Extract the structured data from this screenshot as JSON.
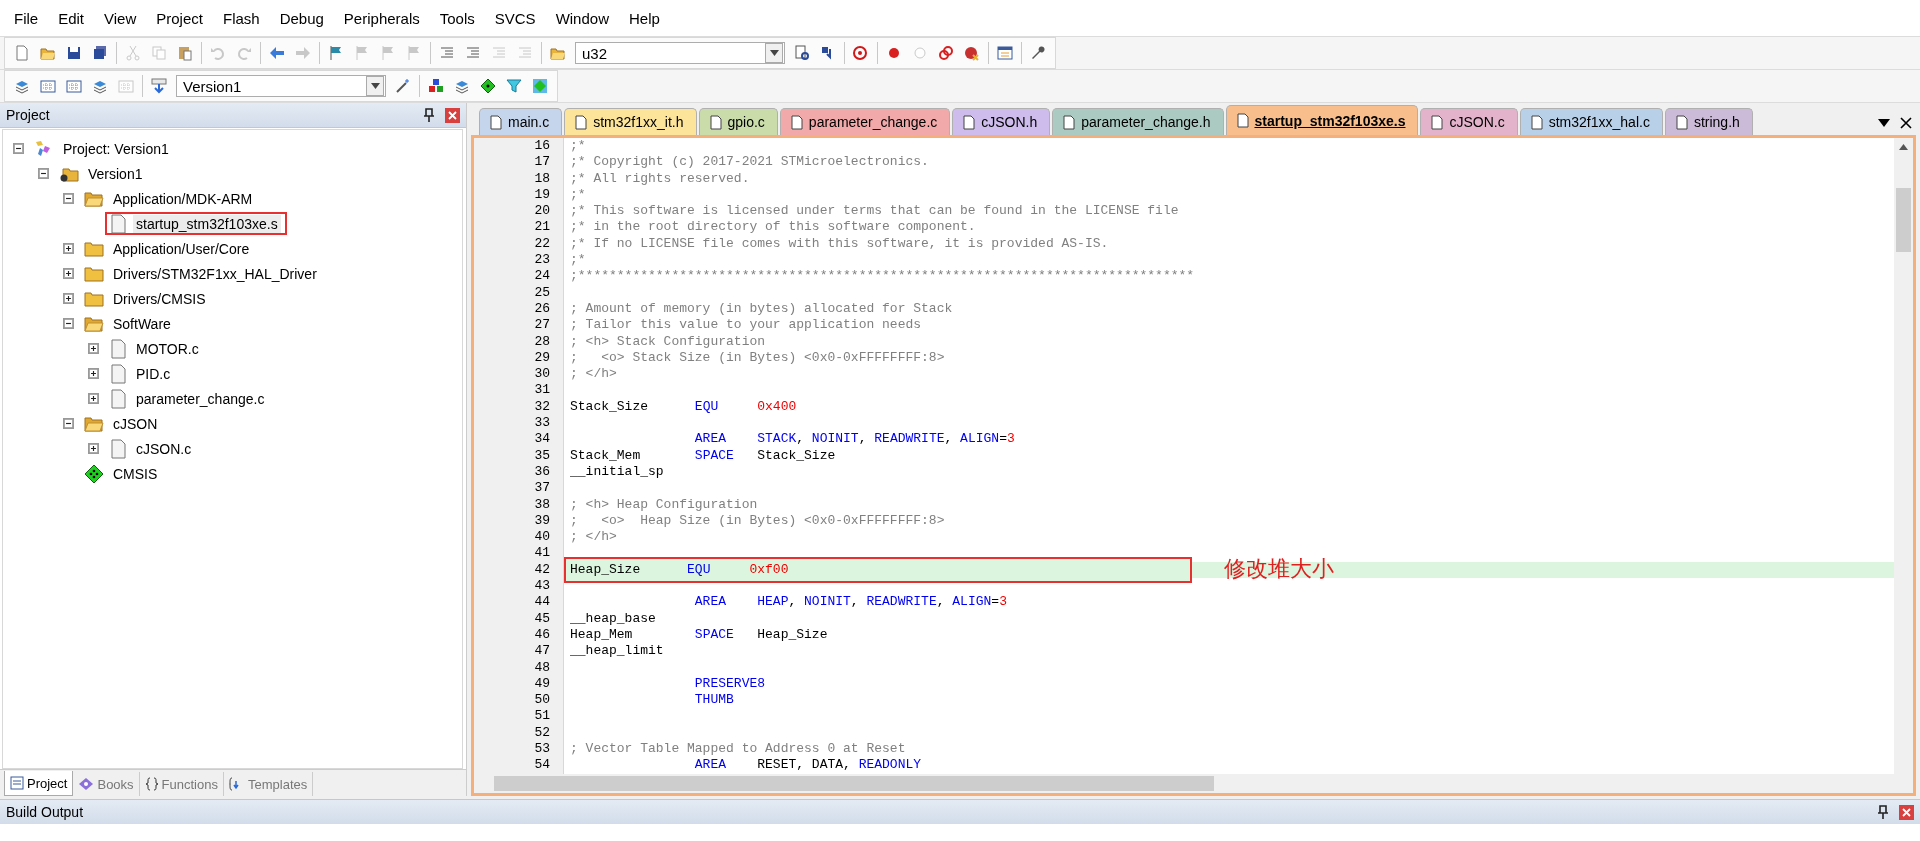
{
  "menu": [
    "File",
    "Edit",
    "View",
    "Project",
    "Flash",
    "Debug",
    "Peripherals",
    "Tools",
    "SVCS",
    "Window",
    "Help"
  ],
  "toolbar_1": [
    {
      "kind": "icon",
      "disabled": false
    },
    {
      "kind": "icon",
      "disabled": false
    },
    {
      "kind": "icon",
      "disabled": false
    },
    {
      "kind": "icon",
      "disabled": false
    },
    {
      "kind": "separator"
    },
    {
      "kind": "icon",
      "disabled": true
    },
    {
      "kind": "icon",
      "disabled": true
    },
    {
      "kind": "icon",
      "disabled": false
    },
    {
      "kind": "separator"
    },
    {
      "kind": "icon",
      "disabled": true
    },
    {
      "kind": "icon",
      "disabled": true
    },
    {
      "kind": "separator"
    },
    {
      "kind": "icon",
      "disabled": false
    },
    {
      "kind": "icon",
      "disabled": true
    },
    {
      "kind": "separator"
    },
    {
      "kind": "icon",
      "disabled": false
    },
    {
      "kind": "icon",
      "disabled": true
    },
    {
      "kind": "icon",
      "disabled": true
    },
    {
      "kind": "icon",
      "disabled": true
    },
    {
      "kind": "separator"
    },
    {
      "kind": "icon",
      "disabled": false
    },
    {
      "kind": "icon",
      "disabled": false
    },
    {
      "kind": "icon",
      "disabled": true
    },
    {
      "kind": "icon",
      "disabled": true
    },
    {
      "kind": "separator"
    },
    {
      "kind": "icon",
      "disabled": false
    },
    {
      "kind": "combo",
      "value": "u32"
    },
    {
      "kind": "icon",
      "disabled": false
    },
    {
      "kind": "icon",
      "disabled": false
    },
    {
      "kind": "separator"
    },
    {
      "kind": "icon",
      "disabled": false
    },
    {
      "kind": "separator"
    },
    {
      "kind": "icon",
      "disabled": false
    },
    {
      "kind": "icon",
      "disabled": true
    },
    {
      "kind": "icon",
      "disabled": false
    },
    {
      "kind": "icon",
      "disabled": false
    },
    {
      "kind": "separator"
    },
    {
      "kind": "icon",
      "disabled": false
    },
    {
      "kind": "separator"
    },
    {
      "kind": "icon",
      "disabled": false
    }
  ],
  "toolbar_2": [
    {
      "kind": "icon",
      "disabled": false
    },
    {
      "kind": "icon",
      "disabled": false
    },
    {
      "kind": "icon",
      "disabled": false
    },
    {
      "kind": "icon",
      "disabled": false
    },
    {
      "kind": "icon",
      "disabled": true
    },
    {
      "kind": "separator"
    },
    {
      "kind": "icon",
      "disabled": false
    },
    {
      "kind": "combo",
      "value": "Version1"
    },
    {
      "kind": "icon",
      "disabled": false
    },
    {
      "kind": "separator"
    },
    {
      "kind": "icon",
      "disabled": false
    },
    {
      "kind": "icon",
      "disabled": false
    },
    {
      "kind": "icon",
      "disabled": false
    },
    {
      "kind": "icon",
      "disabled": false
    },
    {
      "kind": "icon",
      "disabled": false
    }
  ],
  "project_panel": {
    "title": "Project",
    "tree": [
      {
        "kind": "project",
        "label": "Project: Version1",
        "expandable": true,
        "expanded": true,
        "selected": false,
        "marked": false,
        "children": [
          {
            "kind": "target",
            "label": "Version1",
            "expandable": true,
            "expanded": true,
            "selected": false,
            "marked": false,
            "children": [
              {
                "kind": "group",
                "label": "Application/MDK-ARM",
                "expandable": true,
                "expanded": true,
                "selected": false,
                "marked": false,
                "children": [
                  {
                    "kind": "file",
                    "label": "startup_stm32f103xe.s",
                    "expandable": false,
                    "expanded": false,
                    "selected": true,
                    "marked": true
                  }
                ]
              },
              {
                "kind": "group",
                "label": "Application/User/Core",
                "expandable": true,
                "expanded": false,
                "selected": false,
                "marked": false
              },
              {
                "kind": "group",
                "label": "Drivers/STM32F1xx_HAL_Driver",
                "expandable": true,
                "expanded": false,
                "selected": false,
                "marked": false
              },
              {
                "kind": "group",
                "label": "Drivers/CMSIS",
                "expandable": true,
                "expanded": false,
                "selected": false,
                "marked": false
              },
              {
                "kind": "group",
                "label": "SoftWare",
                "expandable": true,
                "expanded": true,
                "selected": false,
                "marked": false,
                "children": [
                  {
                    "kind": "file",
                    "label": "MOTOR.c",
                    "expandable": true,
                    "expanded": false,
                    "selected": false,
                    "marked": false
                  },
                  {
                    "kind": "file",
                    "label": "PID.c",
                    "expandable": true,
                    "expanded": false,
                    "selected": false,
                    "marked": false
                  },
                  {
                    "kind": "file",
                    "label": "parameter_change.c",
                    "expandable": true,
                    "expanded": false,
                    "selected": false,
                    "marked": false
                  }
                ]
              },
              {
                "kind": "group",
                "label": "cJSON",
                "expandable": true,
                "expanded": true,
                "selected": false,
                "marked": false,
                "children": [
                  {
                    "kind": "file",
                    "label": "cJSON.c",
                    "expandable": true,
                    "expanded": false,
                    "selected": false,
                    "marked": false
                  }
                ]
              },
              {
                "kind": "component",
                "label": "CMSIS",
                "expandable": false,
                "expanded": false,
                "selected": false,
                "marked": false
              }
            ]
          }
        ]
      }
    ],
    "tabs": [
      {
        "label": "Project",
        "selected": true
      },
      {
        "label": "Books",
        "selected": false
      },
      {
        "label": "Functions",
        "selected": false
      },
      {
        "label": "Templates",
        "selected": false
      }
    ]
  },
  "editor": {
    "tabs": [
      {
        "label": "main.c",
        "color": "#c5d5ec",
        "selected": false
      },
      {
        "label": "stm32f1xx_it.h",
        "color": "#fce59a",
        "selected": false
      },
      {
        "label": "gpio.c",
        "color": "#c9dcaa",
        "selected": false
      },
      {
        "label": "parameter_change.c",
        "color": "#f2a9a9",
        "selected": false
      },
      {
        "label": "cJSON.h",
        "color": "#cdbcec",
        "selected": false
      },
      {
        "label": "parameter_change.h",
        "color": "#abcbc2",
        "selected": false
      },
      {
        "label": "startup_stm32f103xe.s",
        "color": "#f8bf8c",
        "selected": true
      },
      {
        "label": "cJSON.c",
        "color": "#e3b3cb",
        "selected": false
      },
      {
        "label": "stm32f1xx_hal.c",
        "color": "#b9d1e8",
        "selected": false
      },
      {
        "label": "string.h",
        "color": "#cbbbd9",
        "selected": false
      }
    ],
    "lines": [
      {
        "num": "16",
        "highlighted": false,
        "tokens": [
          {
            "kind": "comment",
            "text": ";*"
          }
        ]
      },
      {
        "num": "17",
        "highlighted": false,
        "tokens": [
          {
            "kind": "comment",
            "text": ";* Copyright (c) 2017-2021 STMicroelectronics."
          }
        ]
      },
      {
        "num": "18",
        "highlighted": false,
        "tokens": [
          {
            "kind": "comment",
            "text": ";* All rights reserved."
          }
        ]
      },
      {
        "num": "19",
        "highlighted": false,
        "tokens": [
          {
            "kind": "comment",
            "text": ";*"
          }
        ]
      },
      {
        "num": "20",
        "highlighted": false,
        "tokens": [
          {
            "kind": "comment",
            "text": ";* This software is licensed under terms that can be found in the LICENSE file"
          }
        ]
      },
      {
        "num": "21",
        "highlighted": false,
        "tokens": [
          {
            "kind": "comment",
            "text": ";* in the root directory of this software component."
          }
        ]
      },
      {
        "num": "22",
        "highlighted": false,
        "tokens": [
          {
            "kind": "comment",
            "text": ";* If no LICENSE file comes with this software, it is provided AS-IS."
          }
        ]
      },
      {
        "num": "23",
        "highlighted": false,
        "tokens": [
          {
            "kind": "comment",
            "text": ";*"
          }
        ]
      },
      {
        "num": "24",
        "highlighted": false,
        "tokens": [
          {
            "kind": "comment",
            "text": ";*******************************************************************************"
          }
        ]
      },
      {
        "num": "25",
        "highlighted": false
      },
      {
        "num": "26",
        "highlighted": false,
        "tokens": [
          {
            "kind": "comment",
            "text": "; Amount of memory (in bytes) allocated for Stack"
          }
        ]
      },
      {
        "num": "27",
        "highlighted": false,
        "tokens": [
          {
            "kind": "comment",
            "text": "; Tailor this value to your application needs"
          }
        ]
      },
      {
        "num": "28",
        "highlighted": false,
        "tokens": [
          {
            "kind": "comment",
            "text": "; <h> Stack Configuration"
          }
        ]
      },
      {
        "num": "29",
        "highlighted": false,
        "tokens": [
          {
            "kind": "comment",
            "text": ";   <o> Stack Size (in Bytes) <0x0-0xFFFFFFFF:8>"
          }
        ]
      },
      {
        "num": "30",
        "highlighted": false,
        "tokens": [
          {
            "kind": "comment",
            "text": "; </h>"
          }
        ]
      },
      {
        "num": "31",
        "highlighted": false
      },
      {
        "num": "32",
        "highlighted": false,
        "tokens": [
          {
            "kind": "plain",
            "text": "Stack_Size      "
          },
          {
            "kind": "keyword",
            "text": "EQU     "
          },
          {
            "kind": "number",
            "text": "0x400"
          }
        ]
      },
      {
        "num": "33",
        "highlighted": false
      },
      {
        "num": "34",
        "highlighted": false,
        "tokens": [
          {
            "kind": "keyword",
            "text": "                AREA    STACK"
          },
          {
            "kind": "plain",
            "text": ", "
          },
          {
            "kind": "keyword",
            "text": "NOINIT"
          },
          {
            "kind": "plain",
            "text": ", "
          },
          {
            "kind": "keyword",
            "text": "READWRITE"
          },
          {
            "kind": "plain",
            "text": ", "
          },
          {
            "kind": "keyword",
            "text": "ALIGN"
          },
          {
            "kind": "plain",
            "text": "="
          },
          {
            "kind": "number",
            "text": "3"
          }
        ]
      },
      {
        "num": "35",
        "highlighted": false,
        "tokens": [
          {
            "kind": "plain",
            "text": "Stack_Mem       "
          },
          {
            "kind": "keyword",
            "text": "SPACE"
          },
          {
            "kind": "plain",
            "text": "   Stack_Size"
          }
        ]
      },
      {
        "num": "36",
        "highlighted": false,
        "tokens": [
          {
            "kind": "plain",
            "text": "__initial_sp"
          }
        ]
      },
      {
        "num": "37",
        "highlighted": false
      },
      {
        "num": "38",
        "highlighted": false,
        "tokens": [
          {
            "kind": "comment",
            "text": "; <h> Heap Configuration"
          }
        ]
      },
      {
        "num": "39",
        "highlighted": false,
        "tokens": [
          {
            "kind": "comment",
            "text": ";   <o>  Heap Size (in Bytes) <0x0-0xFFFFFFFF:8>"
          }
        ]
      },
      {
        "num": "40",
        "highlighted": false,
        "tokens": [
          {
            "kind": "comment",
            "text": "; </h>"
          }
        ]
      },
      {
        "num": "41",
        "highlighted": false
      },
      {
        "num": "42",
        "highlighted": true,
        "note": "修改堆大小",
        "tokens": [
          {
            "kind": "plain",
            "text": "Heap_Size      "
          },
          {
            "kind": "keyword",
            "text": "EQU     "
          },
          {
            "kind": "number",
            "text": "0xf00"
          }
        ]
      },
      {
        "num": "43",
        "highlighted": false
      },
      {
        "num": "44",
        "highlighted": false,
        "tokens": [
          {
            "kind": "keyword",
            "text": "                AREA    HEAP"
          },
          {
            "kind": "plain",
            "text": ", "
          },
          {
            "kind": "keyword",
            "text": "NOINIT"
          },
          {
            "kind": "plain",
            "text": ", "
          },
          {
            "kind": "keyword",
            "text": "READWRITE"
          },
          {
            "kind": "plain",
            "text": ", "
          },
          {
            "kind": "keyword",
            "text": "ALIGN"
          },
          {
            "kind": "plain",
            "text": "="
          },
          {
            "kind": "number",
            "text": "3"
          }
        ]
      },
      {
        "num": "45",
        "highlighted": false,
        "tokens": [
          {
            "kind": "plain",
            "text": "__heap_base"
          }
        ]
      },
      {
        "num": "46",
        "highlighted": false,
        "tokens": [
          {
            "kind": "plain",
            "text": "Heap_Mem        "
          },
          {
            "kind": "keyword",
            "text": "SPACE"
          },
          {
            "kind": "plain",
            "text": "   Heap_Size"
          }
        ]
      },
      {
        "num": "47",
        "highlighted": false,
        "tokens": [
          {
            "kind": "plain",
            "text": "__heap_limit"
          }
        ]
      },
      {
        "num": "48",
        "highlighted": false
      },
      {
        "num": "49",
        "highlighted": false,
        "tokens": [
          {
            "kind": "keyword",
            "text": "                PRESERVE8"
          }
        ]
      },
      {
        "num": "50",
        "highlighted": false,
        "tokens": [
          {
            "kind": "keyword",
            "text": "                THUMB"
          }
        ]
      },
      {
        "num": "51",
        "highlighted": false
      },
      {
        "num": "52",
        "highlighted": false
      },
      {
        "num": "53",
        "highlighted": false,
        "tokens": [
          {
            "kind": "comment",
            "text": "; Vector Table Mapped to Address 0 at Reset"
          }
        ]
      },
      {
        "num": "54",
        "highlighted": false,
        "tokens": [
          {
            "kind": "keyword",
            "text": "                AREA    "
          },
          {
            "kind": "plain",
            "text": "RESET, DATA, "
          },
          {
            "kind": "keyword",
            "text": "READONLY"
          }
        ]
      }
    ]
  },
  "build_output": {
    "title": "Build Output"
  }
}
